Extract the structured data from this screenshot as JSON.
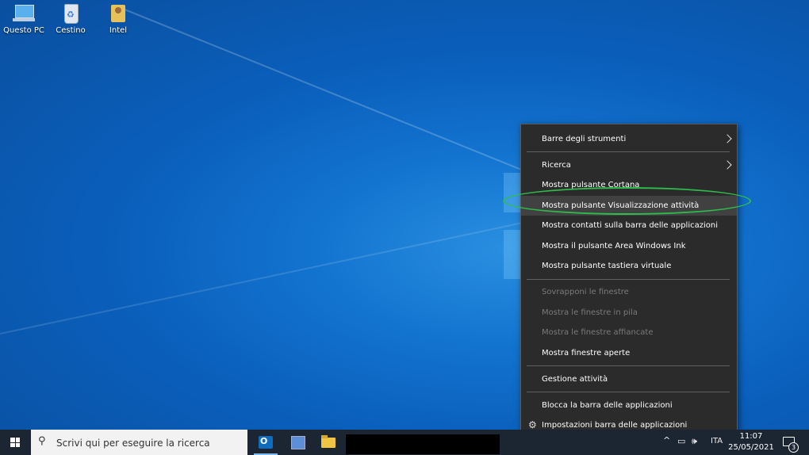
{
  "desktop": {
    "icons": [
      {
        "label": "Questo PC",
        "icon": "computer-icon"
      },
      {
        "label": "Cestino",
        "icon": "recycle-bin-icon"
      },
      {
        "label": "Intel",
        "icon": "user-folder-icon"
      }
    ]
  },
  "context_menu": {
    "items": [
      {
        "label": "Barre degli strumenti",
        "submenu": true
      },
      {
        "label": "Ricerca",
        "submenu": true
      },
      {
        "label": "Mostra pulsante Cortana"
      },
      {
        "label": "Mostra pulsante Visualizzazione attività"
      },
      {
        "label": "Mostra contatti sulla barra delle applicazioni"
      },
      {
        "label": "Mostra il pulsante Area Windows Ink"
      },
      {
        "label": "Mostra pulsante tastiera virtuale"
      },
      {
        "label": "Sovrapponi le finestre",
        "disabled": true
      },
      {
        "label": "Mostra le finestre in pila",
        "disabled": true
      },
      {
        "label": "Mostra le finestre affiancate",
        "disabled": true
      },
      {
        "label": "Mostra finestre aperte"
      },
      {
        "label": "Gestione attività"
      },
      {
        "label": "Blocca la barra delle applicazioni"
      },
      {
        "label": "Impostazioni barra delle applicazioni",
        "icon": "gear-icon"
      }
    ],
    "highlight_color": "#2ebd4d"
  },
  "taskbar": {
    "search_placeholder": "Scrivi qui per eseguire la ricerca",
    "language": "ITA",
    "time": "11:07",
    "date": "25/05/2021",
    "notification_count": "3"
  }
}
